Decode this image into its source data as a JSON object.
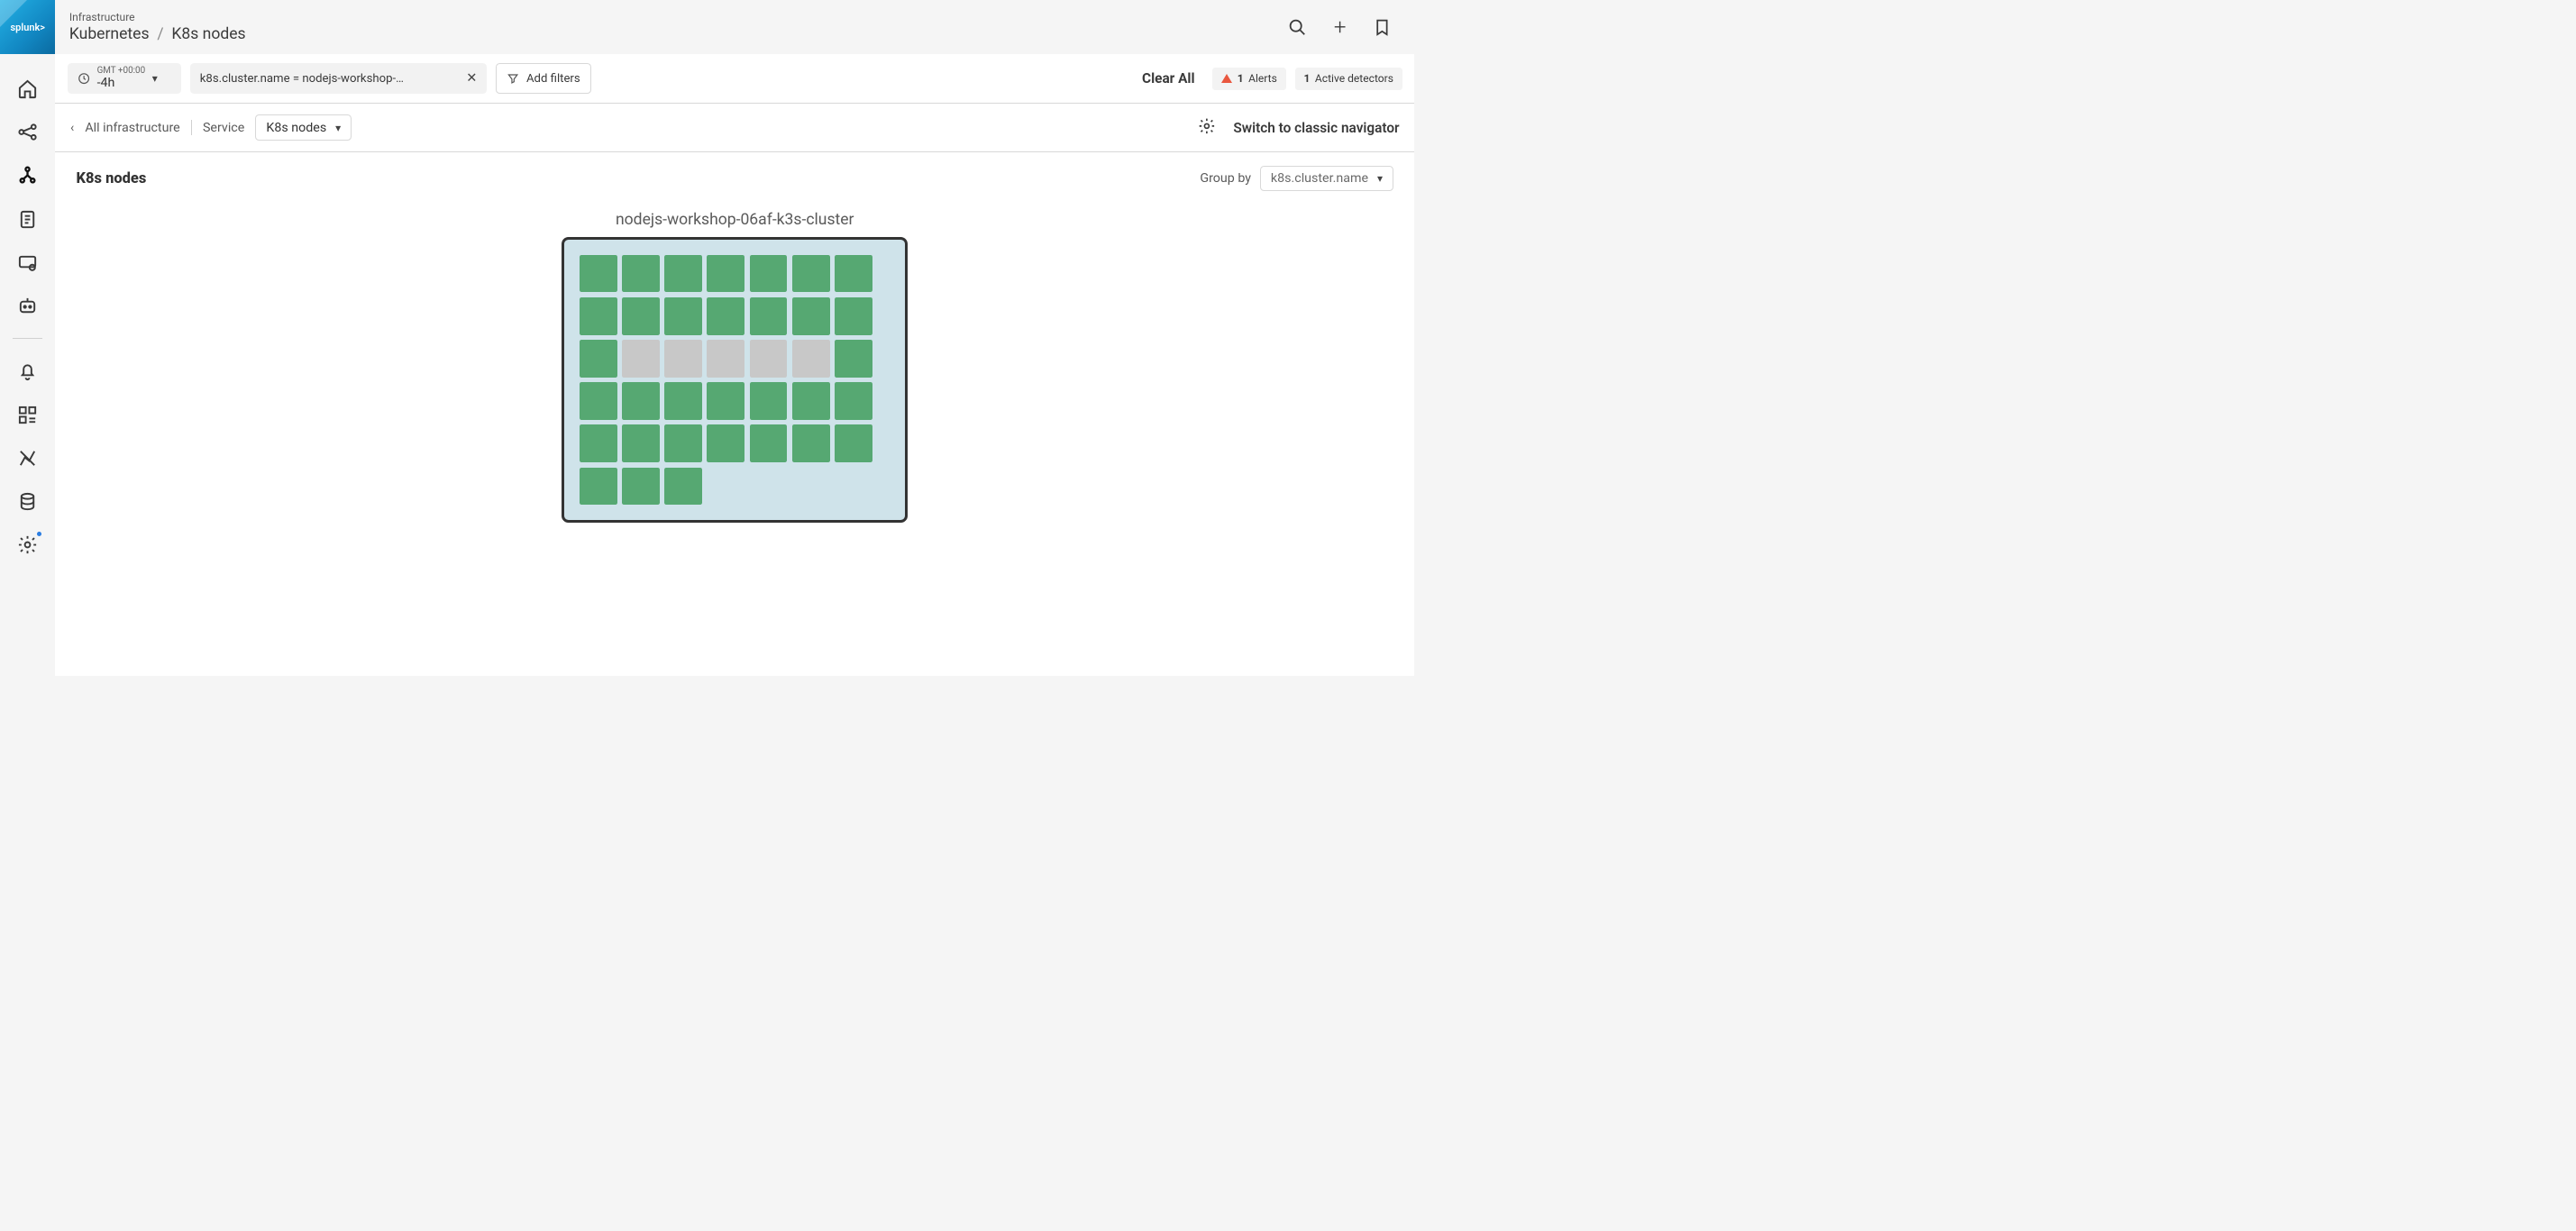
{
  "header": {
    "super": "Infrastructure",
    "crumb1": "Kubernetes",
    "crumb2": "K8s nodes",
    "logo_text": "splunk>"
  },
  "filterbar": {
    "timezone": "GMT +00:00",
    "range": "-4h",
    "filter_text": "k8s.cluster.name = nodejs-workshop-…",
    "add_filters": "Add filters",
    "clear_all": "Clear All",
    "alerts_count": "1",
    "alerts_label": "Alerts",
    "detectors_count": "1",
    "detectors_label": "Active detectors"
  },
  "navrow": {
    "back_label": "All infrastructure",
    "service_label": "Service",
    "service_value": "K8s nodes",
    "switch_label": "Switch to classic navigator"
  },
  "content": {
    "title": "K8s nodes",
    "groupby_label": "Group by",
    "groupby_value": "k8s.cluster.name"
  },
  "cluster": {
    "title": "nodejs-workshop-06af-k3s-cluster",
    "nodes": [
      "g",
      "g",
      "g",
      "g",
      "g",
      "g",
      "g",
      "g",
      "g",
      "g",
      "g",
      "g",
      "g",
      "g",
      "g",
      "x",
      "x",
      "x",
      "x",
      "x",
      "g",
      "g",
      "g",
      "g",
      "g",
      "g",
      "g",
      "g",
      "g",
      "g",
      "g",
      "g",
      "g",
      "g",
      "g",
      "g",
      "g",
      "g"
    ]
  }
}
